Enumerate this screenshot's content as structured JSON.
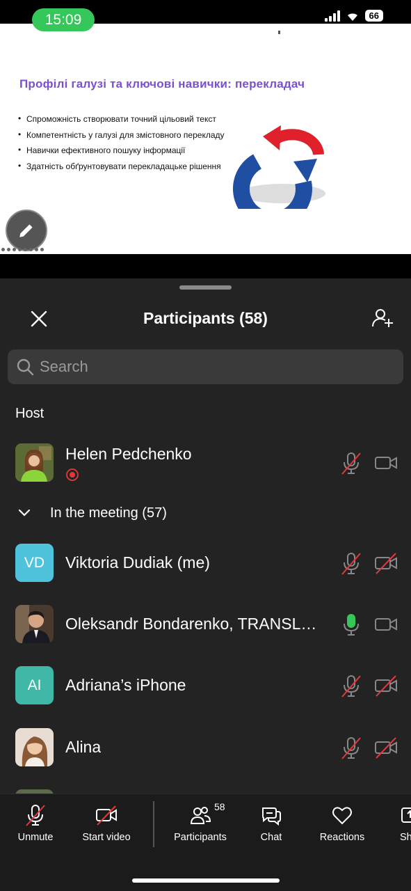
{
  "status_bar": {
    "time": "15:09",
    "battery": "66"
  },
  "slide": {
    "title": "Профілі галузі та ключові навички: перекладач",
    "bullets": [
      "Спроможність створювати точний цільовий текст",
      "Компетентність у галузі для змістовного перекладу",
      "Навички ефективного пошуку інформації",
      "Здатність обґрунтовувати перекладацьке рішення"
    ]
  },
  "sheet": {
    "title": "Participants (58)",
    "search_placeholder": "Search",
    "host_section": "Host",
    "meeting_section": "In the meeting (57)"
  },
  "host": {
    "name": "Helen Pedchenko",
    "mic": "muted",
    "camera": "on",
    "recording": true
  },
  "participants": [
    {
      "initials": "VD",
      "name": "Viktoria Dudiak (me)",
      "avatar_color": "#4fc3dc",
      "mic": "muted",
      "camera": "off"
    },
    {
      "initials": "",
      "name": "Oleksandr Bondarenko, TRANSLA...",
      "mic": "on",
      "camera": "on"
    },
    {
      "initials": "AI",
      "name": "Adriana’s iPhone",
      "avatar_color": "#3fb8a8",
      "mic": "muted",
      "camera": "off"
    },
    {
      "initials": "",
      "name": "Alina",
      "mic": "muted",
      "camera": "off"
    }
  ],
  "toolbar": {
    "unmute": "Unmute",
    "start_video": "Start video",
    "participants": "Participants",
    "participants_count": "58",
    "chat": "Chat",
    "reactions": "Reactions",
    "share": "Sh"
  }
}
